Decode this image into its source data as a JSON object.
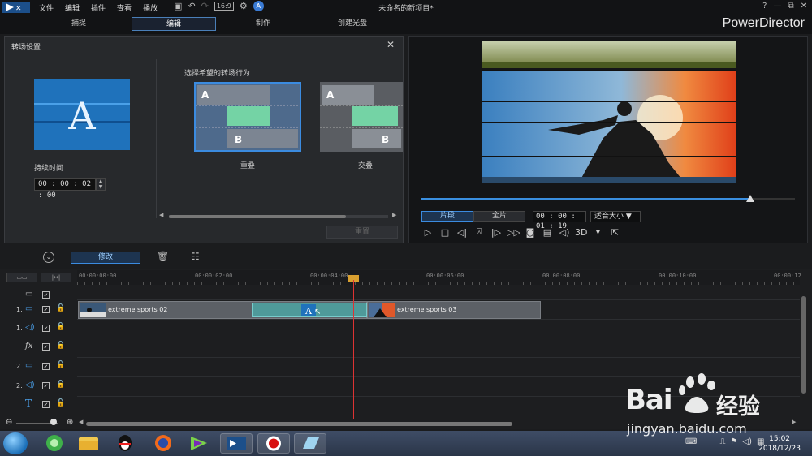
{
  "menu": [
    "文件",
    "编辑",
    "插件",
    "查看",
    "播放"
  ],
  "window_title": "未命名的新项目*",
  "window_controls": [
    "?",
    "—",
    "⧉",
    "✕"
  ],
  "modes": [
    {
      "label": "捕捉",
      "active": false
    },
    {
      "label": "编辑",
      "active": true
    },
    {
      "label": "制作",
      "active": false
    },
    {
      "label": "创建光盘",
      "active": false
    }
  ],
  "brand": "PowerDirector",
  "transition_panel": {
    "title": "转场设置",
    "duration_label": "持续时间",
    "duration_value": "00 : 00 : 02 : 00",
    "choose_label": "选择希望的转场行为",
    "options": [
      {
        "label": "重叠",
        "selected": true
      },
      {
        "label": "交叠",
        "selected": false
      }
    ],
    "reset_label": "重置"
  },
  "preview": {
    "clip_label": "片段",
    "movie_label": "全片",
    "timecode": "00 : 00 : 01 : 19",
    "fit_label": "适合大小",
    "three_d_label": "3D",
    "seek_progress": 0.88
  },
  "edit_toolbar": {
    "modify_label": "修改"
  },
  "timeline": {
    "ticks": [
      "00:00:00:00",
      "00:00:02:00",
      "00:00:04:00",
      "00:00:06:00",
      "00:00:08:00",
      "00:00:10:00",
      "00:00:12"
    ],
    "tracks": [
      {
        "num": "",
        "icon": "master-video"
      },
      {
        "num": "1.",
        "icon": "video"
      },
      {
        "num": "1.",
        "icon": "audio"
      },
      {
        "num": "",
        "icon": "fx"
      },
      {
        "num": "2.",
        "icon": "video"
      },
      {
        "num": "2.",
        "icon": "audio"
      },
      {
        "num": "",
        "icon": "title"
      }
    ],
    "clips": [
      {
        "name": "extreme sports 02"
      },
      {
        "name": "extreme sports 03"
      }
    ],
    "fx_label": "fx",
    "title_label": "T"
  },
  "taskbar": {
    "time": "15:02",
    "date": "2018/12/23"
  },
  "watermark": {
    "brand": "Bai",
    "brand2": "经验",
    "url": "jingyan.baidu.com"
  }
}
